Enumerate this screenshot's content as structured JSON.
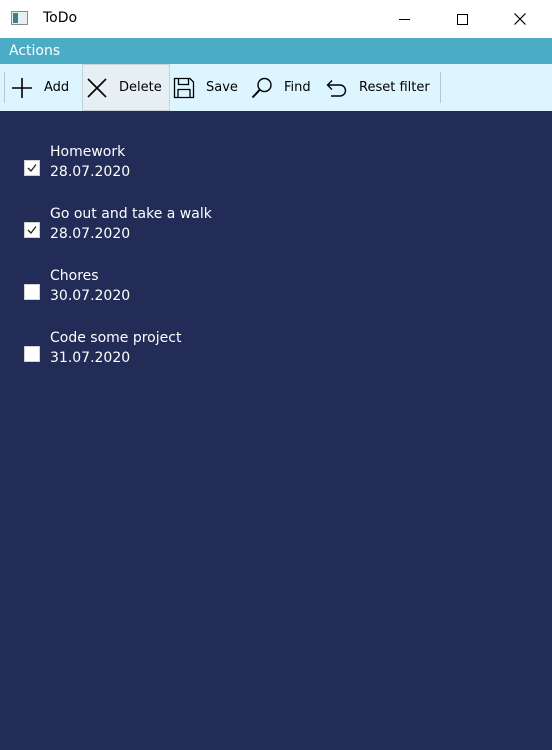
{
  "window": {
    "title": "ToDo",
    "icon": "app-window-icon"
  },
  "menu": {
    "items": [
      {
        "label": "Actions"
      }
    ]
  },
  "toolbar": {
    "buttons": [
      {
        "label": "Add",
        "icon": "plus-icon"
      },
      {
        "label": "Delete",
        "icon": "x-icon"
      },
      {
        "label": "Save",
        "icon": "floppy-disk-icon"
      },
      {
        "label": "Find",
        "icon": "magnifier-icon"
      },
      {
        "label": "Reset filter",
        "icon": "undo-arrow-icon"
      }
    ]
  },
  "todos": [
    {
      "title": "Homework",
      "date": "28.07.2020",
      "done": true
    },
    {
      "title": "Go out and take a walk",
      "date": "28.07.2020",
      "done": true
    },
    {
      "title": "Chores",
      "date": "30.07.2020",
      "done": false
    },
    {
      "title": "Code some project",
      "date": "31.07.2020",
      "done": false
    }
  ],
  "colors": {
    "menubar": "#4bacc6",
    "toolbar": "#ddf5ff",
    "content_background": "#232b57",
    "item_text": "#ffffff"
  }
}
